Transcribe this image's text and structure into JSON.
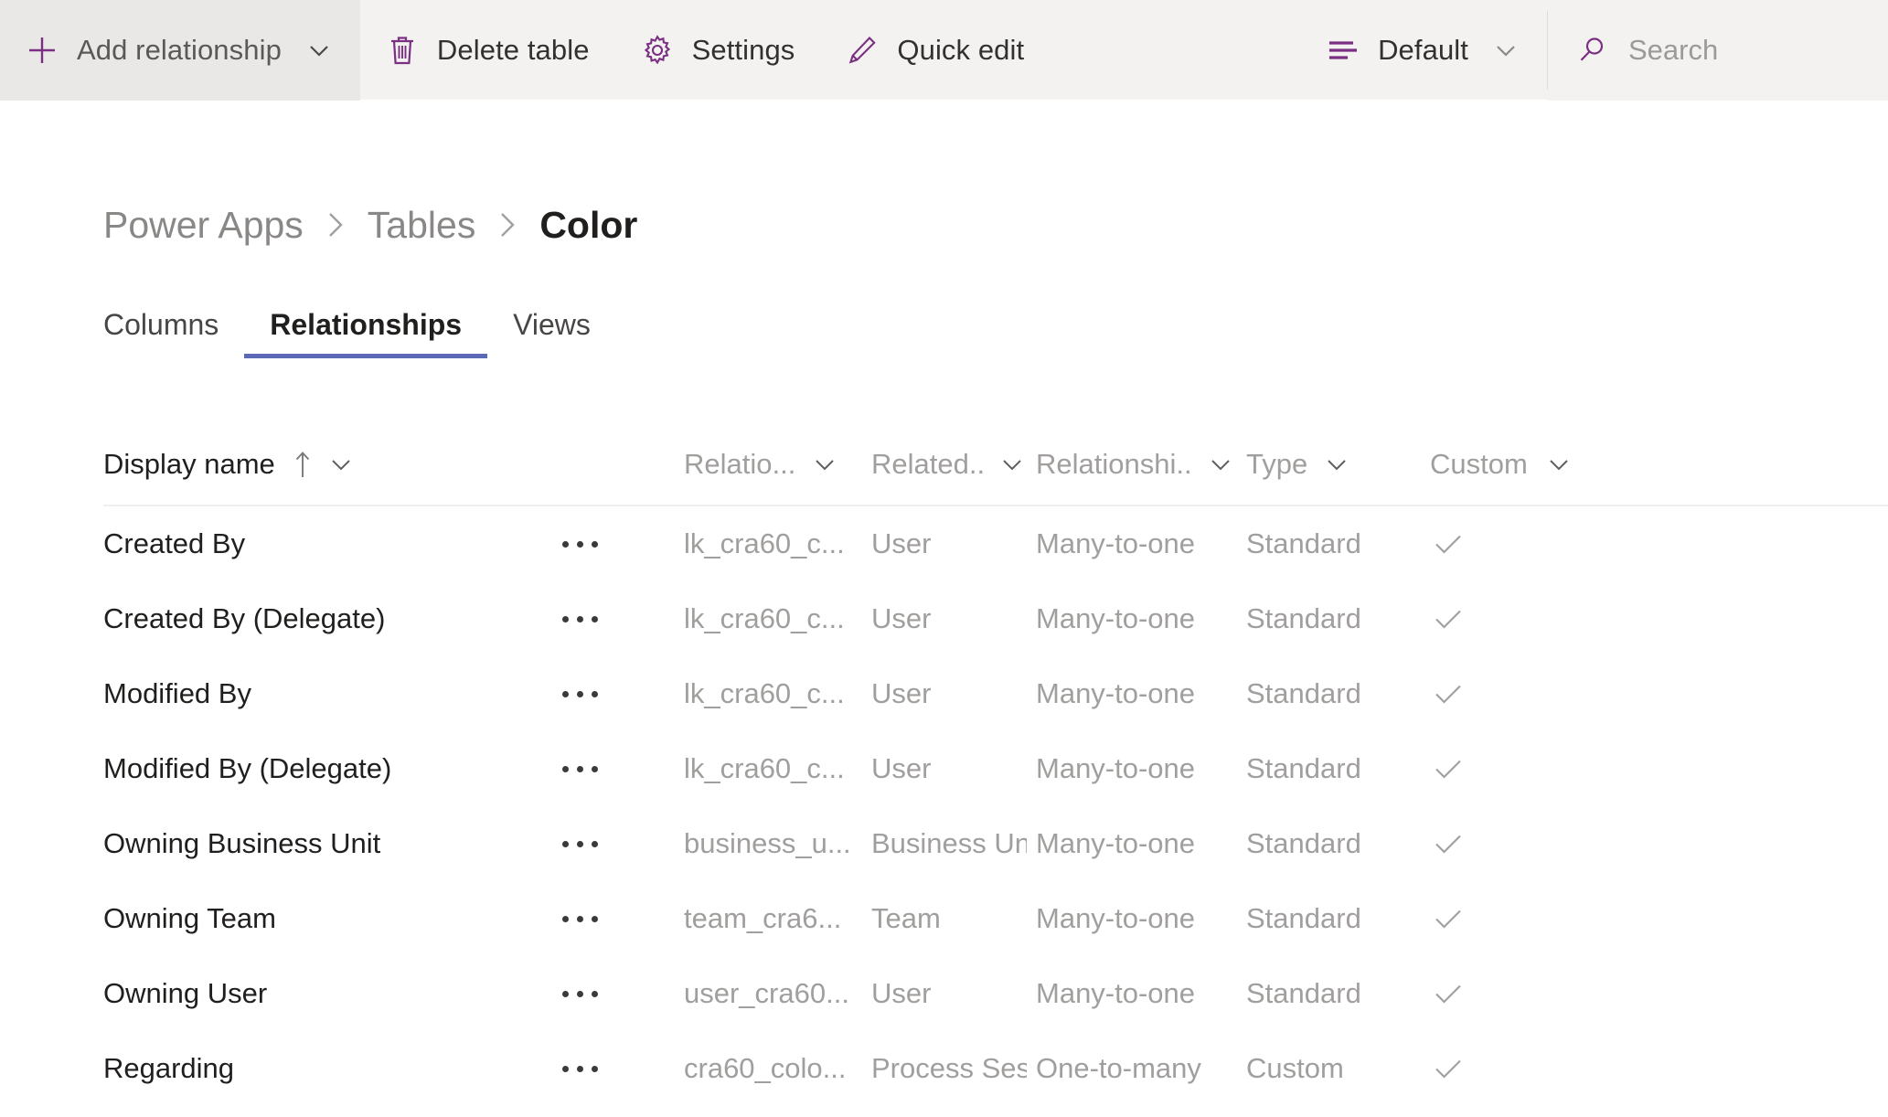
{
  "toolbar": {
    "add_relationship": {
      "label": "Add relationship",
      "icon": "plus-icon",
      "chevron": "chevron-down-icon"
    },
    "delete_table": {
      "label": "Delete table",
      "icon": "trash-icon"
    },
    "settings": {
      "label": "Settings",
      "icon": "gear-icon"
    },
    "quick_edit": {
      "label": "Quick edit",
      "icon": "pencil-icon"
    },
    "view_selector": {
      "label": "Default",
      "icon": "list-lines-icon",
      "chevron": "chevron-down-icon"
    },
    "search": {
      "placeholder": "Search",
      "icon": "search-icon",
      "value": ""
    },
    "accent_color": "#7a2f82"
  },
  "breadcrumb": {
    "items": [
      {
        "label": "Power Apps",
        "current": false
      },
      {
        "label": "Tables",
        "current": false
      },
      {
        "label": "Color",
        "current": true
      }
    ],
    "separator": "chevron-right-icon"
  },
  "tabs": {
    "items": [
      {
        "label": "Columns",
        "active": false
      },
      {
        "label": "Relationships",
        "active": true
      },
      {
        "label": "Views",
        "active": false
      }
    ],
    "active_underline_color": "#5c68b8"
  },
  "grid": {
    "columns": [
      {
        "label": "Display name",
        "sorted": true,
        "sort_direction": "ascending",
        "sort_icon": "arrow-up-icon",
        "menu_icon": "chevron-down-icon"
      },
      {
        "label": "Relatio...",
        "sorted": false,
        "menu_icon": "chevron-down-icon"
      },
      {
        "label": "Related...",
        "sorted": false,
        "menu_icon": "chevron-down-icon"
      },
      {
        "label": "Relationshi...",
        "sorted": false,
        "menu_icon": "chevron-down-icon"
      },
      {
        "label": "Type",
        "sorted": false,
        "menu_icon": "chevron-down-icon"
      },
      {
        "label": "Custom...",
        "sorted": false,
        "menu_icon": "chevron-down-icon"
      }
    ],
    "row_menu_icon": "more-options-icon",
    "customizable_icon": "checkmark-icon",
    "rows": [
      {
        "display_name": "Created By",
        "relationship_name": "lk_cra60_c...",
        "related_table": "User",
        "relationship_type": "Many-to-one",
        "type": "Standard",
        "customizable": true
      },
      {
        "display_name": "Created By (Delegate)",
        "relationship_name": "lk_cra60_c...",
        "related_table": "User",
        "relationship_type": "Many-to-one",
        "type": "Standard",
        "customizable": true
      },
      {
        "display_name": "Modified By",
        "relationship_name": "lk_cra60_c...",
        "related_table": "User",
        "relationship_type": "Many-to-one",
        "type": "Standard",
        "customizable": true
      },
      {
        "display_name": "Modified By (Delegate)",
        "relationship_name": "lk_cra60_c...",
        "related_table": "User",
        "relationship_type": "Many-to-one",
        "type": "Standard",
        "customizable": true
      },
      {
        "display_name": "Owning Business Unit",
        "relationship_name": "business_u...",
        "related_table": "Business Unit",
        "relationship_type": "Many-to-one",
        "type": "Standard",
        "customizable": true
      },
      {
        "display_name": "Owning Team",
        "relationship_name": "team_cra6...",
        "related_table": "Team",
        "relationship_type": "Many-to-one",
        "type": "Standard",
        "customizable": true
      },
      {
        "display_name": "Owning User",
        "relationship_name": "user_cra60...",
        "related_table": "User",
        "relationship_type": "Many-to-one",
        "type": "Standard",
        "customizable": true
      },
      {
        "display_name": "Regarding",
        "relationship_name": "cra60_colo...",
        "related_table": "Process Sessi",
        "relationship_type": "One-to-many",
        "type": "Custom",
        "customizable": true
      }
    ]
  }
}
